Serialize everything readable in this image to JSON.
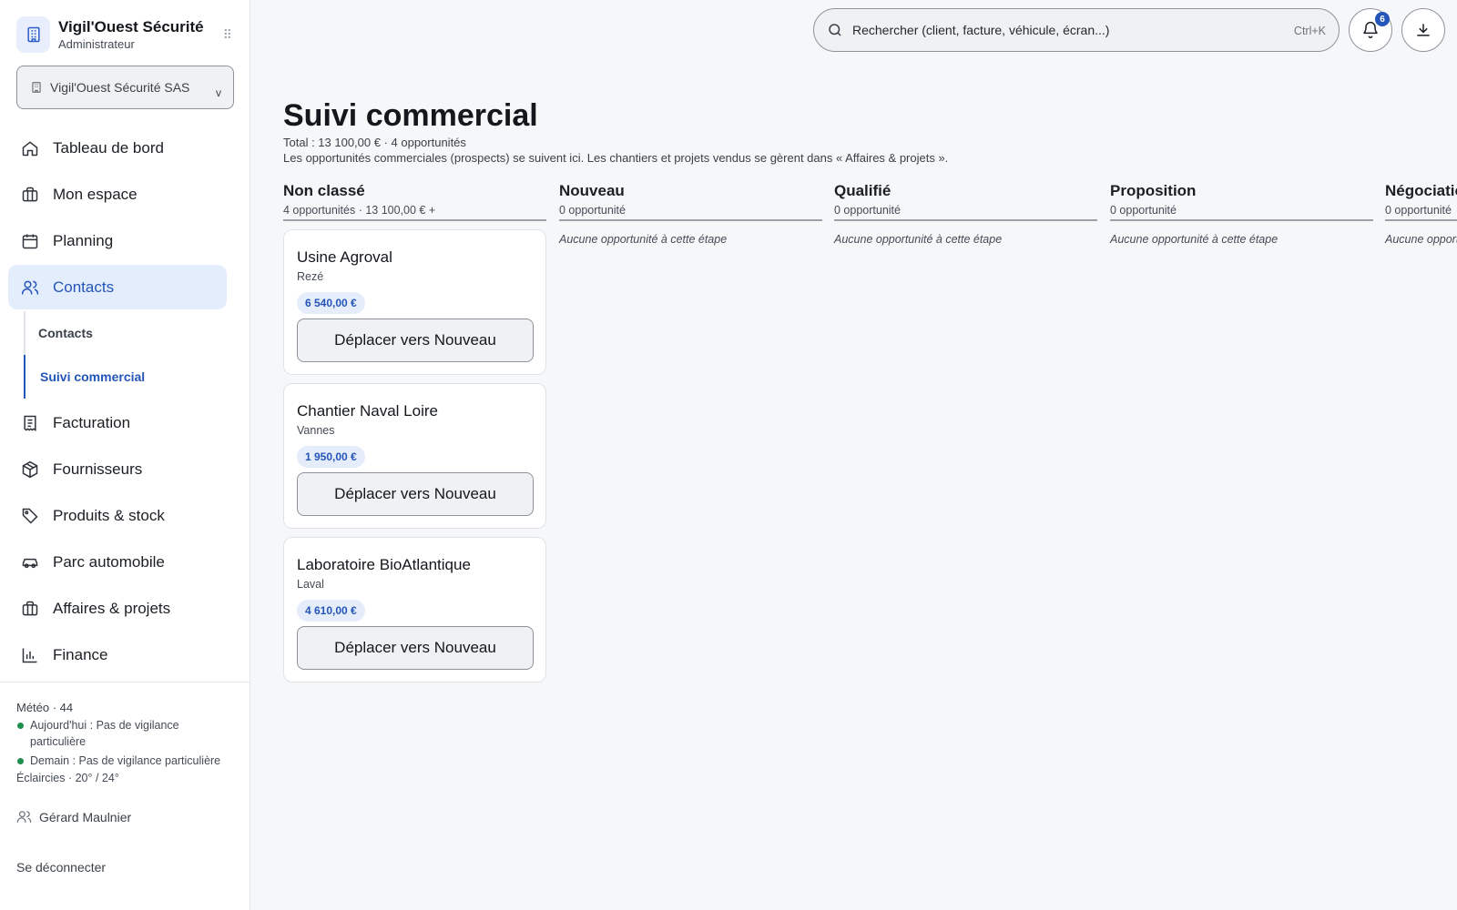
{
  "brand": {
    "name": "Vigil'Ouest Sécurité",
    "role": "Administrateur",
    "logo_icon": "building-icon",
    "grip_glyph": "⠿"
  },
  "org_select": {
    "value": "Vigil'Ouest Sécurité SAS",
    "chevron": "v"
  },
  "nav": {
    "items": [
      {
        "label": "Tableau de bord",
        "icon": "home-icon"
      },
      {
        "label": "Mon espace",
        "icon": "briefcase-icon"
      },
      {
        "label": "Planning",
        "icon": "calendar-icon"
      },
      {
        "label": "Contacts",
        "icon": "users-icon",
        "active": true
      },
      {
        "label": "Facturation",
        "icon": "receipt-icon"
      },
      {
        "label": "Fournisseurs",
        "icon": "package-icon"
      },
      {
        "label": "Produits & stock",
        "icon": "tag-icon"
      },
      {
        "label": "Parc automobile",
        "icon": "car-icon"
      },
      {
        "label": "Affaires & projets",
        "icon": "briefcase-icon"
      },
      {
        "label": "Finance",
        "icon": "bar-chart-icon"
      }
    ],
    "sub_items": [
      {
        "label": "Contacts"
      },
      {
        "label": "Suivi commercial",
        "active": true
      }
    ]
  },
  "sidebar_footer": {
    "meteo_title": "Météo · 44",
    "today": "Aujourd'hui : Pas de vigilance particulière",
    "tomorrow": "Demain : Pas de vigilance particulière",
    "forecast": "Éclaircies · 20° / 24°",
    "user_name": "Gérard Maulnier",
    "logout": "Se déconnecter"
  },
  "topbar": {
    "search_placeholder": "Rechercher (client, facture, véhicule, écran...)",
    "shortcut": "Ctrl+K",
    "notification_count": "6"
  },
  "page": {
    "title": "Suivi commercial",
    "total": "Total : 13 100,00 € · 4 opportunités",
    "helper": "Les opportunités commerciales (prospects) se suivent ici. Les chantiers et projets vendus se gèrent dans « Affaires & projets »."
  },
  "board": {
    "columns": [
      {
        "title": "Non classé",
        "count": "4 opportunités · 13 100,00 € +"
      },
      {
        "title": "Nouveau",
        "count": "0 opportunité",
        "empty": "Aucune opportunité à cette étape"
      },
      {
        "title": "Qualifié",
        "count": "0 opportunité",
        "empty": "Aucune opportunité à cette étape"
      },
      {
        "title": "Proposition",
        "count": "0 opportunité",
        "empty": "Aucune opportunité à cette étape"
      },
      {
        "title": "Négociation",
        "count": "0 opportunité",
        "empty": "Aucune opportunité à cette étape"
      }
    ],
    "cards": [
      {
        "title": "Usine Agroval",
        "city": "Rezé",
        "amount": "6 540,00 €",
        "action": "Déplacer vers Nouveau"
      },
      {
        "title": "Chantier Naval Loire",
        "city": "Vannes",
        "amount": "1 950,00 €",
        "action": "Déplacer vers Nouveau"
      },
      {
        "title": "Laboratoire BioAtlantique",
        "city": "Laval",
        "amount": "4 610,00 €",
        "action": "Déplacer vers Nouveau"
      }
    ]
  },
  "colors": {
    "accent": "#2455b8",
    "active_bg": "#e4edfc",
    "status_green": "#1e8f4e"
  }
}
